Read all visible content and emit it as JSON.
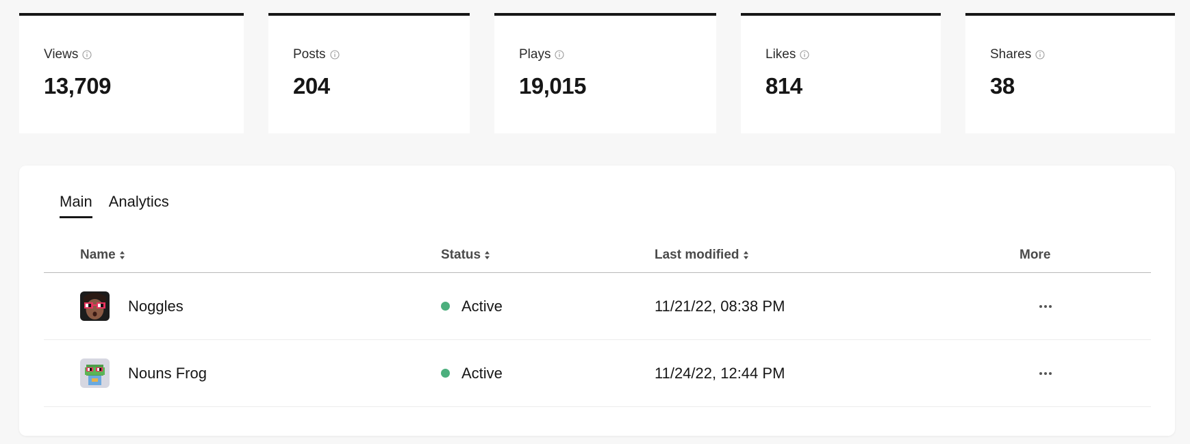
{
  "stats": [
    {
      "label": "Views",
      "value": "13,709"
    },
    {
      "label": "Posts",
      "value": "204"
    },
    {
      "label": "Plays",
      "value": "19,015"
    },
    {
      "label": "Likes",
      "value": "814"
    },
    {
      "label": "Shares",
      "value": "38"
    }
  ],
  "tabs": [
    {
      "label": "Main",
      "active": true
    },
    {
      "label": "Analytics",
      "active": false
    }
  ],
  "table": {
    "columns": {
      "name": "Name",
      "status": "Status",
      "modified": "Last modified",
      "more": "More"
    },
    "rows": [
      {
        "name": "Noggles",
        "avatar": "noggles-avatar",
        "status": "Active",
        "modified": "11/21/22, 08:38 PM"
      },
      {
        "name": "Nouns Frog",
        "avatar": "frog-avatar",
        "status": "Active",
        "modified": "11/24/22, 12:44 PM"
      }
    ]
  },
  "colors": {
    "active_status": "#4caf7d",
    "card_border": "#161616"
  },
  "icons": {
    "info": "info-icon",
    "sort": "sort-icon",
    "more": "more-icon"
  }
}
